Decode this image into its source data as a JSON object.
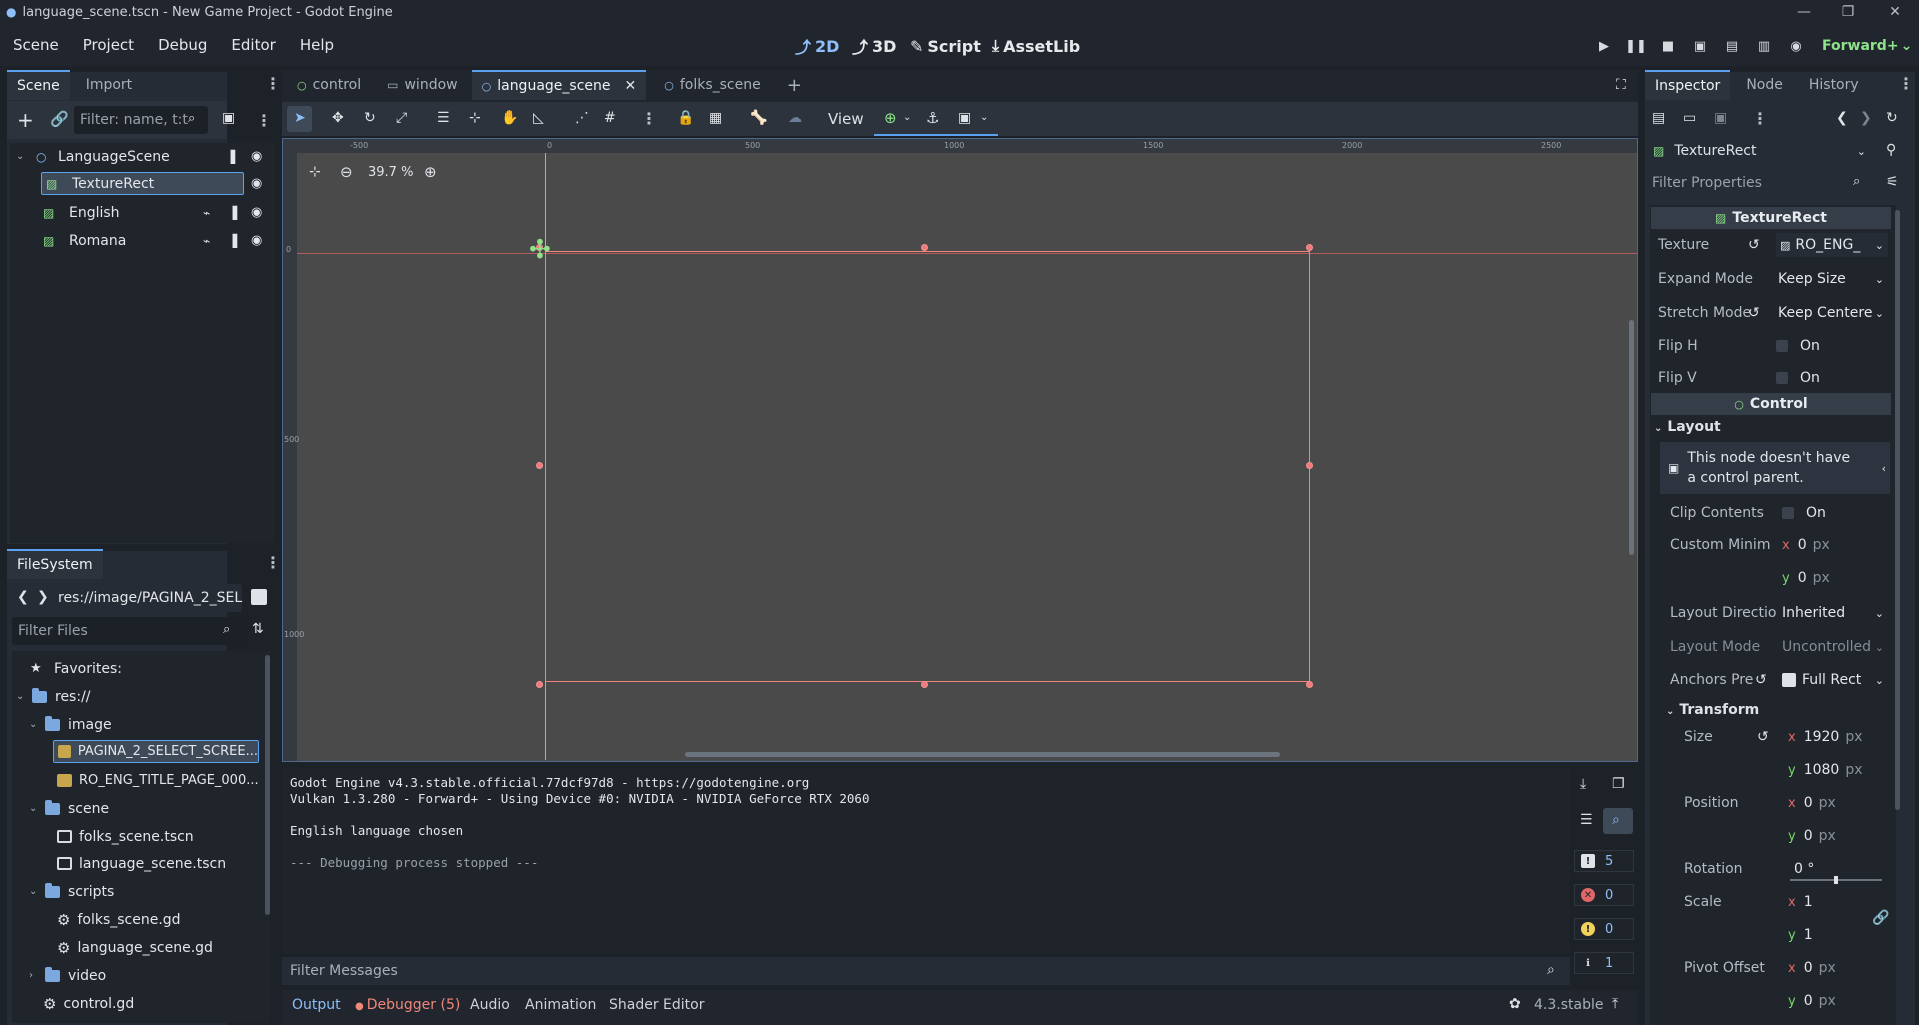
{
  "window": {
    "title": "language_scene.tscn - New Game Project - Godot Engine",
    "controls": [
      "—",
      "❐",
      "✕"
    ]
  },
  "menu": [
    "Scene",
    "Project",
    "Debug",
    "Editor",
    "Help"
  ],
  "main_screens": {
    "d2": "2D",
    "d3": "3D",
    "script": "Script",
    "assetlib": "AssetLib"
  },
  "renderer": "Forward+",
  "scene_dock": {
    "tabs": [
      "Scene",
      "Import"
    ],
    "filter_placeholder": "Filter: name, t:t",
    "tree": [
      {
        "label": "LanguageScene"
      },
      {
        "label": "TextureRect"
      },
      {
        "label": "English"
      },
      {
        "label": "Romana"
      }
    ]
  },
  "filesystem": {
    "tab": "FileSystem",
    "path": "res://image/PAGINA_2_SEL",
    "filter_placeholder": "Filter Files",
    "items": [
      {
        "label": "Favorites:"
      },
      {
        "label": "res://"
      },
      {
        "label": "image"
      },
      {
        "label": "PAGINA_2_SELECT_SCREE..."
      },
      {
        "label": "RO_ENG_TITLE_PAGE_000..."
      },
      {
        "label": "scene"
      },
      {
        "label": "folks_scene.tscn"
      },
      {
        "label": "language_scene.tscn"
      },
      {
        "label": "scripts"
      },
      {
        "label": "folks_scene.gd"
      },
      {
        "label": "language_scene.gd"
      },
      {
        "label": "video"
      },
      {
        "label": "control.gd"
      }
    ]
  },
  "scene_tabs": [
    "control",
    "window",
    "language_scene",
    "folks_scene"
  ],
  "toolbar": {
    "view": "View"
  },
  "viewport": {
    "zoom": "39.7 %",
    "ruler_top": [
      "-500",
      "0",
      "500",
      "1000",
      "1500",
      "2000",
      "2500"
    ],
    "ruler_left": [
      "0",
      "500",
      "1000"
    ]
  },
  "output": {
    "lines": [
      "Godot Engine v4.3.stable.official.77dcf97d8 - https://godotengine.org",
      "Vulkan 1.3.280 - Forward+ - Using Device #0: NVIDIA - NVIDIA GeForce RTX 2060",
      "",
      "English language chosen",
      "",
      "--- Debugging process stopped ---"
    ],
    "filter_placeholder": "Filter Messages",
    "counters": {
      "messages": "5",
      "errors": "0",
      "warnings": "0",
      "info": "1"
    }
  },
  "bottom_tabs": {
    "output": "Output",
    "debugger": "Debugger (5)",
    "audio": "Audio",
    "animation": "Animation",
    "shader": "Shader Editor"
  },
  "version": "4.3.stable",
  "inspector": {
    "tabs": [
      "Inspector",
      "Node",
      "History"
    ],
    "object": "TextureRect",
    "filter_placeholder": "Filter Properties",
    "section_texture_rect": "TextureRect",
    "texture": {
      "label": "Texture",
      "value": "RO_ENG_"
    },
    "expand_mode": {
      "label": "Expand Mode",
      "value": "Keep Size"
    },
    "stretch_mode": {
      "label": "Stretch Mode",
      "value": "Keep Centere"
    },
    "flip_h": {
      "label": "Flip H",
      "value": "On"
    },
    "flip_v": {
      "label": "Flip V",
      "value": "On"
    },
    "section_control": "Control",
    "layout": "Layout",
    "layout_warning": "This node doesn't have a control parent.",
    "clip_contents": {
      "label": "Clip Contents",
      "value": "On"
    },
    "custom_min": {
      "label": "Custom Minim",
      "x": "0",
      "y": "0",
      "unit": "px"
    },
    "layout_direction": {
      "label": "Layout Directio",
      "value": "Inherited"
    },
    "layout_mode": {
      "label": "Layout Mode",
      "value": "Uncontrolled"
    },
    "anchors_preset": {
      "label": "Anchors Pre",
      "value": "Full Rect"
    },
    "transform": "Transform",
    "size": {
      "label": "Size",
      "x": "1920",
      "y": "1080",
      "unit": "px"
    },
    "position": {
      "label": "Position",
      "x": "0",
      "y": "0",
      "unit": "px"
    },
    "rotation": {
      "label": "Rotation",
      "value": "0 °"
    },
    "scale": {
      "label": "Scale",
      "x": "1",
      "y": "1"
    },
    "pivot_offset": {
      "label": "Pivot Offset",
      "x": "0",
      "y": "0",
      "unit": "px"
    }
  }
}
